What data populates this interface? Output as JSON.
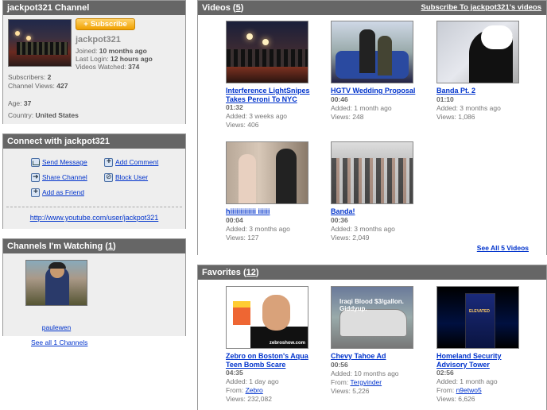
{
  "channel": {
    "header": "jackpot321 Channel",
    "subscribe_label": "Subscribe",
    "name": "jackpot321",
    "joined_label": "Joined:",
    "joined_value": "10 months ago",
    "last_login_label": "Last Login:",
    "last_login_value": "12 hours ago",
    "videos_watched_label": "Videos Watched:",
    "videos_watched_value": "374",
    "subscribers_label": "Subscribers:",
    "subscribers_value": "2",
    "channel_views_label": "Channel Views:",
    "channel_views_value": "427",
    "age_label": "Age:",
    "age_value": "37",
    "country_label": "Country:",
    "country_value": "United States"
  },
  "connect": {
    "header": "Connect with jackpot321",
    "send_message": "Send Message",
    "add_comment": "Add Comment",
    "share_channel": "Share Channel",
    "block_user": "Block User",
    "add_friend": "Add as Friend",
    "url": "http://www.youtube.com/user/jackpot321"
  },
  "watching": {
    "header": "Channels I'm Watching",
    "count": "1",
    "open_paren": "(",
    "close_paren": ")",
    "channel_name": "paulewen",
    "see_all": "See all 1 Channels"
  },
  "videos": {
    "header": "Videos",
    "count": "5",
    "subscribe_link": "Subscribe To jackpot321's videos",
    "see_all": "See All 5 Videos",
    "items": [
      {
        "title": "Interference LightSnipes Takes Peroni To NYC",
        "duration": "01:32",
        "added": "Added: 3 weeks ago",
        "views": "Views: 406"
      },
      {
        "title": "HGTV Wedding Proposal",
        "duration": "00:46",
        "added": "Added: 1 month ago",
        "views": "Views: 248"
      },
      {
        "title": "Banda Pt. 2",
        "duration": "01:10",
        "added": "Added: 3 months ago",
        "views": "Views: 1,086"
      },
      {
        "title": "hiiiiiiiiiiiii iiiiii",
        "duration": "00:04",
        "added": "Added: 3 months ago",
        "views": "Views: 127"
      },
      {
        "title": "Banda!",
        "duration": "00:36",
        "added": "Added: 3 months ago",
        "views": "Views: 2,049"
      }
    ]
  },
  "favorites": {
    "header": "Favorites",
    "count": "12",
    "from_label": "From:",
    "items": [
      {
        "title": "Zebro on Boston's Aqua Teen Bomb Scare",
        "duration": "04:35",
        "added": "Added: 1 day ago",
        "from": "Zebro",
        "views": "Views: 232,082",
        "thumb_text": "zebroshow.com"
      },
      {
        "title": "Chevy Tahoe Ad",
        "duration": "00:56",
        "added": "Added: 10 months ago",
        "from": "Tergvinder",
        "views": "Views: 5,226",
        "thumb_text": "Iraqi Blood $3/gallon. Giddyup."
      },
      {
        "title": "Homeland Security Advisory Tower",
        "duration": "02:56",
        "added": "Added: 1 month ago",
        "from": "n9etwo5",
        "views": "Views: 6,626",
        "thumb_text": "ELEVATED"
      }
    ]
  }
}
